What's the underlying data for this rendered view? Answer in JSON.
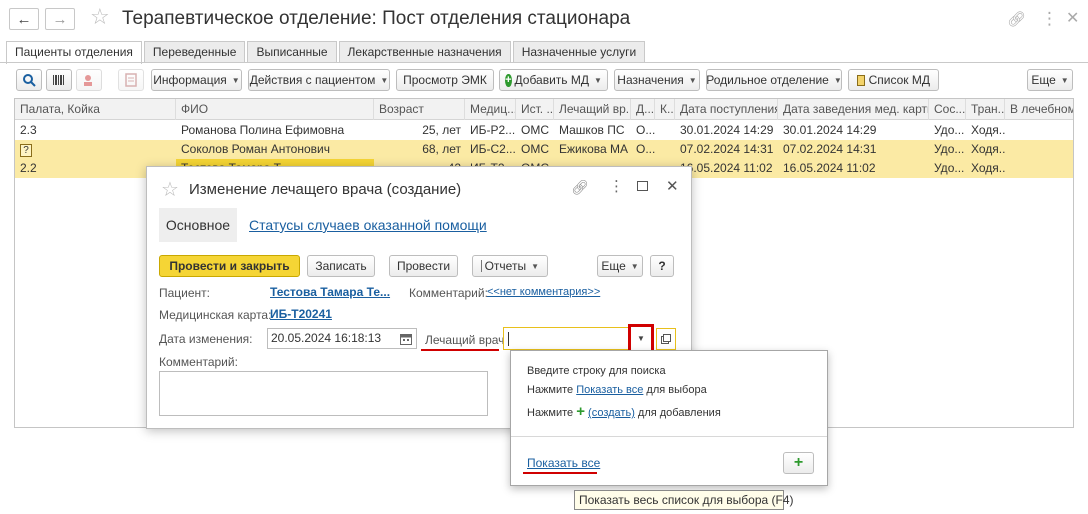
{
  "window": {
    "title": "Терапевтическое отделение: Пост отделения стационара",
    "back_icon": "←",
    "forward_icon": "→",
    "star_icon": "☆"
  },
  "tabs": [
    {
      "label": "Пациенты отделения"
    },
    {
      "label": "Переведенные"
    },
    {
      "label": "Выписанные"
    },
    {
      "label": "Лекарственные назначения"
    },
    {
      "label": "Назначенные услуги"
    }
  ],
  "toolbar": {
    "info": "Информация",
    "actions": "Действия с пациентом",
    "emk": "Просмотр ЭМК",
    "add_md": "Добавить МД",
    "assignments": "Назначения",
    "maternity": "Родильное отделение",
    "md_list": "Список МД",
    "more": "Еще"
  },
  "table": {
    "columns": [
      "Палата, Койка",
      "ФИО",
      "Возраст",
      "Медиц...",
      "Ист. ...",
      "Лечащий вр...",
      "Д...",
      "К...",
      "Дата поступления",
      "Дата заведения мед. карты",
      "Сос...",
      "Тран...",
      "В лечебном"
    ],
    "rows": [
      {
        "ward": "2.3",
        "name": "Романова Полина Ефимовна",
        "age": "25, лет",
        "card": "ИБ-Р2...",
        "source": "ОМС",
        "doctor": "Машков ПС",
        "d": "О...",
        "admission": "30.01.2024 14:29",
        "card_date": "30.01.2024 14:29",
        "state": "Удо...",
        "transport": "Ходя..."
      },
      {
        "ward": "?",
        "name": "Соколов Роман Антонович",
        "age": "68, лет",
        "card": "ИБ-С2...",
        "source": "ОМС",
        "doctor": "Ежикова МА",
        "d": "О...",
        "admission": "07.02.2024 14:31",
        "card_date": "07.02.2024 14:31",
        "state": "Удо...",
        "transport": "Ходя..."
      },
      {
        "ward": "2.2",
        "name": "Тестова Тамара Т...",
        "age": "42",
        "card": "ИБ-Т2...",
        "source": "ОМС",
        "doctor": "",
        "d": "",
        "admission": "16.05.2024 11:02",
        "card_date": "16.05.2024 11:02",
        "state": "Удо...",
        "transport": "Ходя..."
      }
    ]
  },
  "dialog": {
    "title": "Изменение лечащего врача (создание)",
    "tab_main": "Основное",
    "tab_statuses": "Статусы случаев оказанной помощи",
    "post_close": "Провести и закрыть",
    "save": "Записать",
    "post": "Провести",
    "reports": "Отчеты",
    "more": "Еще",
    "help": "?",
    "patient_label": "Пациент:",
    "patient_value": "Тестова Тамара Те...",
    "comment_label_inline": "Комментарий:",
    "comment_link": "<<нет комментария>>",
    "card_label": "Медицинская карта:",
    "card_value": "ИБ-Т20241",
    "date_label": "Дата изменения:",
    "date_value": "20.05.2024 16:18:13",
    "doctor_label": "Лечащий врач:",
    "doctor_value": "",
    "comment_label": "Комментарий:",
    "comment_value": ""
  },
  "popup": {
    "line1": "Введите строку для поиска",
    "line2_a": "Нажмите ",
    "line2_link": "Показать все",
    "line2_b": " для выбора",
    "line3_a": "Нажмите ",
    "line3_link": "(создать)",
    "line3_b": " для добавления",
    "show_all": "Показать все"
  },
  "tooltip": "Показать весь список для выбора (F4)",
  "colors": {
    "selected_row": "#fbeaa4",
    "accent_yellow": "#f5d535",
    "link_blue": "#1a5fa0",
    "annotation_red": "#d00000",
    "plus_green": "#2e9a2e"
  }
}
